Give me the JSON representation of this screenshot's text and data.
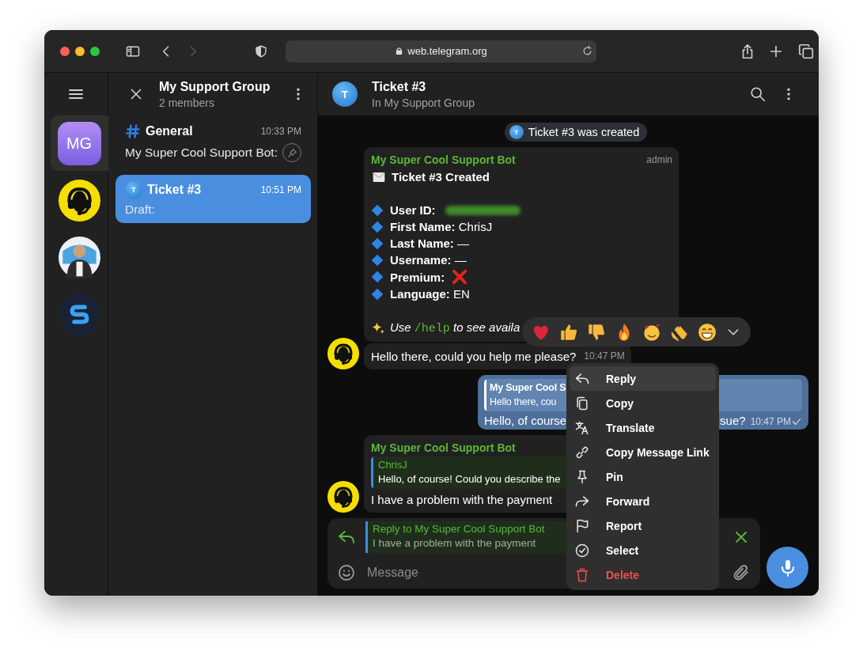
{
  "browser": {
    "url": "web.telegram.org",
    "forward_disabled": true
  },
  "rail": {
    "items": [
      {
        "kind": "initials",
        "label": "MG",
        "selected": true
      },
      {
        "kind": "headset",
        "selected": false
      },
      {
        "kind": "picture",
        "selected": false
      },
      {
        "kind": "logo",
        "selected": false
      }
    ]
  },
  "group_panel": {
    "title": "My Support Group",
    "subtitle": "2 members"
  },
  "chats": [
    {
      "kind": "hash",
      "name": "General",
      "time": "10:33 PM",
      "preview": "My Super Cool Support Bot:",
      "pinned": true,
      "selected": false
    },
    {
      "kind": "bubble",
      "icon_letter": "T",
      "name": "Ticket #3",
      "time": "10:51 PM",
      "preview": "Draft:",
      "pinned": false,
      "selected": true
    }
  ],
  "chat_header": {
    "avatar_letter": "T",
    "title": "Ticket #3",
    "subtitle": "In My Support Group"
  },
  "service_message": {
    "icon_letter": "T",
    "text": "Ticket #3 was created"
  },
  "card": {
    "sender": "My Super Cool Support Bot",
    "badge": "admin",
    "title": "Ticket #3 Created",
    "fields": [
      {
        "label": "User ID:",
        "kind": "redacted"
      },
      {
        "label": "First Name:",
        "kind": "text",
        "value": "ChrisJ"
      },
      {
        "label": "Last Name:",
        "kind": "text",
        "value": "—"
      },
      {
        "label": "Username:",
        "kind": "text",
        "value": "—"
      },
      {
        "label": "Premium:",
        "kind": "cross"
      },
      {
        "label": "Language:",
        "kind": "text",
        "value": "EN"
      }
    ],
    "hint": {
      "before": "Use ",
      "code": "/help",
      "after": " to see availa"
    }
  },
  "incoming_1": {
    "text": "Hello there, could you help me please?",
    "time": "10:47 PM"
  },
  "outgoing": {
    "quote_sender": "My Super Cool S",
    "quote_text": "Hello there, cou",
    "text_start": "Hello, of course",
    "text_end": "sue?",
    "time": "10:47 PM",
    "sent": true
  },
  "incoming_2": {
    "sender": "My Super Cool Support Bot",
    "quote_sender": "ChrisJ",
    "quote_text": "Hello, of course! Could you describe the",
    "text": "I have a problem with the payment"
  },
  "composer": {
    "reply_title": "Reply to My Super Cool Support Bot",
    "reply_text": "I have a problem with the payment",
    "placeholder": "Message"
  },
  "reactions": [
    {
      "kind": "heart"
    },
    {
      "kind": "thumbs_up"
    },
    {
      "kind": "thumbs_down"
    },
    {
      "kind": "fire"
    },
    {
      "kind": "hearts_face"
    },
    {
      "kind": "clap"
    },
    {
      "kind": "grin"
    }
  ],
  "context_menu": [
    {
      "kind": "reply",
      "label": "Reply",
      "danger": false,
      "selected": true
    },
    {
      "kind": "copy",
      "label": "Copy",
      "danger": false,
      "selected": false
    },
    {
      "kind": "translate",
      "label": "Translate",
      "danger": false,
      "selected": false
    },
    {
      "kind": "link",
      "label": "Copy Message Link",
      "danger": false,
      "selected": false
    },
    {
      "kind": "pin",
      "label": "Pin",
      "danger": false,
      "selected": false
    },
    {
      "kind": "forward",
      "label": "Forward",
      "danger": false,
      "selected": false
    },
    {
      "kind": "flag",
      "label": "Report",
      "danger": false,
      "selected": false
    },
    {
      "kind": "select",
      "label": "Select",
      "danger": false,
      "selected": false
    },
    {
      "kind": "delete",
      "label": "Delete",
      "danger": true,
      "selected": false
    }
  ]
}
